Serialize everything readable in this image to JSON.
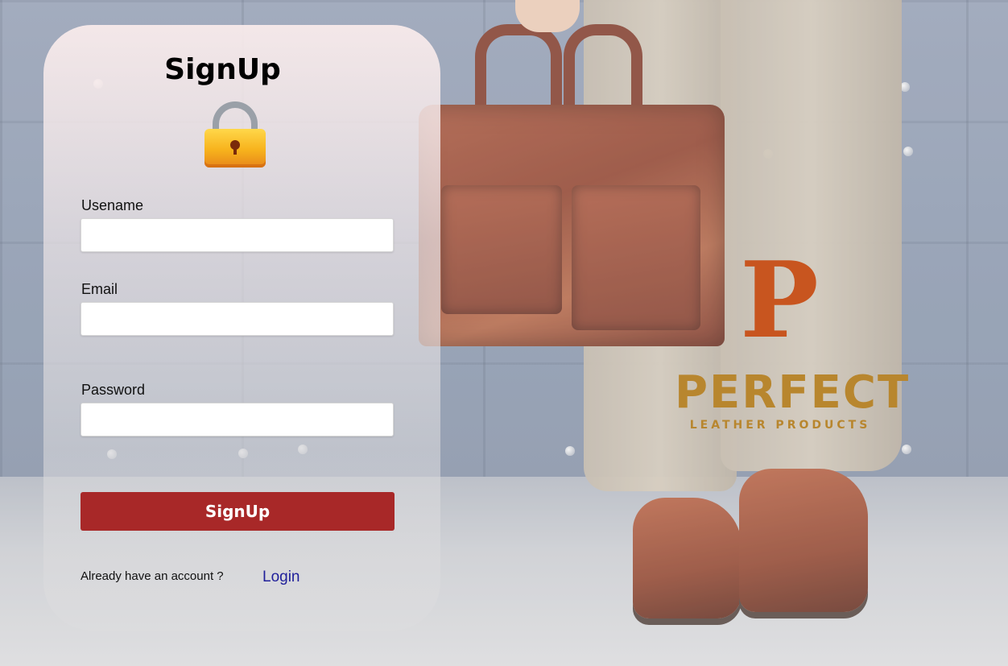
{
  "form": {
    "title": "SignUp",
    "username_label": "Usename",
    "username_value": "",
    "email_label": "Email",
    "email_value": "",
    "password_label": "Password",
    "password_value": "",
    "submit_label": "SignUp",
    "already_text": "Already have an account ?",
    "login_link": "Login"
  },
  "brand": {
    "logo_letter": "P",
    "logo_word": "PERFECT",
    "logo_subtitle": "LEATHER PRODUCTS"
  },
  "icons": {
    "lock": "lock-icon"
  },
  "colors": {
    "button": "#a82828",
    "link": "#1f1f9a",
    "logo_orange": "#c8551f",
    "logo_gold": "#b8862e"
  }
}
